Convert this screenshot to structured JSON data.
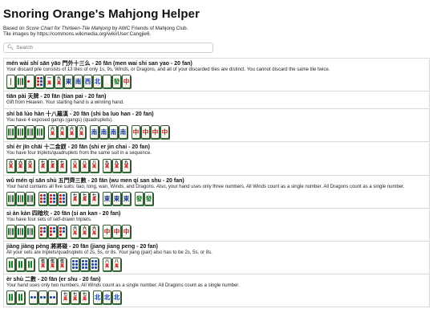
{
  "page": {
    "title": "Snoring Orange's Mahjong Helper",
    "based_on_prefix": "Based on ",
    "based_on_italic": "Score Chart for Thirteen-Tile Mahjong",
    "based_on_suffix": " by AWC Friends of Mahjong Club.",
    "images_credit": "Tile images by https://commons.wikimedia.org/wiki/User:Cangjie6.",
    "search_placeholder": "Search"
  },
  "icons": {
    "search": "magnifier-icon"
  },
  "hands": [
    {
      "title": "mén wài shí sān yāo 門外十三么 - 20 fān (men wai shi san yao - 20 fan)",
      "desc": "Your discard pile consists of 13 tiles of only 1s, 9s, Winds, or Dragons, and all of your discarded tiles are distinct. You cannot discard the same tile twice.",
      "tiles": [
        {
          "type": "bam",
          "n": 1
        },
        {
          "type": "bam",
          "n": 9
        },
        {
          "type": "dots",
          "n": 1
        },
        {
          "type": "dots",
          "n": 9
        },
        {
          "type": "char",
          "top": "一",
          "w": "萬"
        },
        {
          "type": "char",
          "top": "九",
          "w": "萬"
        },
        {
          "type": "glyph",
          "g": "東",
          "c": "b"
        },
        {
          "type": "glyph",
          "g": "南",
          "c": "b"
        },
        {
          "type": "glyph",
          "g": "西",
          "c": "b"
        },
        {
          "type": "glyph",
          "g": "北",
          "c": "b"
        },
        {
          "type": "blank"
        },
        {
          "type": "glyph",
          "g": "發",
          "c": "g"
        },
        {
          "type": "glyph",
          "g": "中",
          "c": "r"
        }
      ]
    },
    {
      "title": "tiān pài 天牌 - 20 fān (tian pai - 20 fan)",
      "desc": "Gift from Heaven. Your starting hand is a winning hand.",
      "tiles": []
    },
    {
      "title": "shí bā lúo hàn 十八羅漢 - 20 fān (shi ba luo han - 20 fan)",
      "desc": "You have 4 exposed gangs (gangs) (quadruplets).",
      "tiles": [
        {
          "type": "bam",
          "n": 3
        },
        {
          "type": "bam",
          "n": 3
        },
        {
          "type": "bam",
          "n": 3
        },
        {
          "type": "bam",
          "n": 3
        },
        {
          "type": "gap"
        },
        {
          "type": "char",
          "top": "六",
          "w": "萬"
        },
        {
          "type": "char",
          "top": "六",
          "w": "萬"
        },
        {
          "type": "char",
          "top": "六",
          "w": "萬"
        },
        {
          "type": "char",
          "top": "六",
          "w": "萬"
        },
        {
          "type": "gap"
        },
        {
          "type": "glyph",
          "g": "南",
          "c": "b"
        },
        {
          "type": "glyph",
          "g": "南",
          "c": "b"
        },
        {
          "type": "glyph",
          "g": "南",
          "c": "b"
        },
        {
          "type": "glyph",
          "g": "南",
          "c": "b"
        },
        {
          "type": "gap"
        },
        {
          "type": "glyph",
          "g": "中",
          "c": "r"
        },
        {
          "type": "glyph",
          "g": "中",
          "c": "r"
        },
        {
          "type": "glyph",
          "g": "中",
          "c": "r"
        },
        {
          "type": "glyph",
          "g": "中",
          "c": "r"
        }
      ]
    },
    {
      "title": "shí èr jīn chāi 十二金釵 - 20 fān (shi er jin chai - 20 fan)",
      "desc": "You have four triplets/quadruplets from the same suit in a sequence.",
      "tiles": [
        {
          "type": "char",
          "top": "六",
          "w": "萬"
        },
        {
          "type": "char",
          "top": "六",
          "w": "萬"
        },
        {
          "type": "char",
          "top": "六",
          "w": "萬"
        },
        {
          "type": "gap"
        },
        {
          "type": "char",
          "top": "七",
          "w": "萬"
        },
        {
          "type": "char",
          "top": "七",
          "w": "萬"
        },
        {
          "type": "char",
          "top": "七",
          "w": "萬"
        },
        {
          "type": "gap"
        },
        {
          "type": "char",
          "top": "八",
          "w": "萬"
        },
        {
          "type": "char",
          "top": "八",
          "w": "萬"
        },
        {
          "type": "char",
          "top": "八",
          "w": "萬"
        },
        {
          "type": "gap"
        },
        {
          "type": "char",
          "top": "九",
          "w": "萬"
        },
        {
          "type": "char",
          "top": "九",
          "w": "萬"
        },
        {
          "type": "char",
          "top": "九",
          "w": "萬"
        }
      ]
    },
    {
      "title": "wǔ mén qí sān shù 五門齊三數 - 20 fān (wu men qi san shu - 20 fan)",
      "desc": "Your hand contains all five suits: tiao, tong, wan, Winds, and Dragons. Also, your hand uses only three numbers. All Winds count as a single number. All Dragons count as a single number.",
      "tiles": [
        {
          "type": "bam",
          "n": 3
        },
        {
          "type": "bam",
          "n": 3
        },
        {
          "type": "bam",
          "n": 3
        },
        {
          "type": "gap"
        },
        {
          "type": "dots",
          "n": 7
        },
        {
          "type": "dots",
          "n": 7
        },
        {
          "type": "dots",
          "n": 7
        },
        {
          "type": "gap"
        },
        {
          "type": "char",
          "top": "七",
          "w": "萬"
        },
        {
          "type": "char",
          "top": "七",
          "w": "萬"
        },
        {
          "type": "char",
          "top": "七",
          "w": "萬"
        },
        {
          "type": "gap"
        },
        {
          "type": "glyph",
          "g": "東",
          "c": "b"
        },
        {
          "type": "glyph",
          "g": "東",
          "c": "b"
        },
        {
          "type": "glyph",
          "g": "東",
          "c": "b"
        },
        {
          "type": "gap"
        },
        {
          "type": "glyph",
          "g": "發",
          "c": "g"
        },
        {
          "type": "glyph",
          "g": "發",
          "c": "g"
        }
      ]
    },
    {
      "title": "sì àn kàn 四暗坎 - 20 fān (si an kan - 20 fan)",
      "desc": "You have four sets of self-drawn triplets.",
      "tiles": [
        {
          "type": "bam",
          "n": 4
        },
        {
          "type": "bam",
          "n": 4
        },
        {
          "type": "bam",
          "n": 4
        },
        {
          "type": "gap"
        },
        {
          "type": "dots",
          "n": 5
        },
        {
          "type": "dots",
          "n": 5
        },
        {
          "type": "dots",
          "n": 5
        },
        {
          "type": "gap"
        },
        {
          "type": "char",
          "top": "六",
          "w": "萬"
        },
        {
          "type": "char",
          "top": "六",
          "w": "萬"
        },
        {
          "type": "char",
          "top": "六",
          "w": "萬"
        },
        {
          "type": "gap"
        },
        {
          "type": "glyph",
          "g": "中",
          "c": "r"
        },
        {
          "type": "glyph",
          "g": "中",
          "c": "r"
        },
        {
          "type": "glyph",
          "g": "中",
          "c": "r"
        }
      ]
    },
    {
      "title": "jiàng jiàng pèng 將將碰 - 20 fān (jiang jiang peng - 20 fan)",
      "desc": "All your sets are triplets/quadruplets of 2s, 5s, or 8s. Your jiang (pair) also has to be 2s, 5s, or 8s.",
      "tiles": [
        {
          "type": "bam",
          "n": 2
        },
        {
          "type": "bam",
          "n": 2
        },
        {
          "type": "bam",
          "n": 2
        },
        {
          "type": "gap"
        },
        {
          "type": "char",
          "top": "伍",
          "w": "萬"
        },
        {
          "type": "char",
          "top": "伍",
          "w": "萬"
        },
        {
          "type": "char",
          "top": "伍",
          "w": "萬"
        },
        {
          "type": "gap"
        },
        {
          "type": "dots",
          "n": 8
        },
        {
          "type": "dots",
          "n": 8
        },
        {
          "type": "dots",
          "n": 8
        },
        {
          "type": "gap"
        },
        {
          "type": "char",
          "top": "八",
          "w": "萬"
        },
        {
          "type": "char",
          "top": "八",
          "w": "萬"
        }
      ]
    },
    {
      "title": "èr shù 二數 - 20 fān (er shu - 20 fan)",
      "desc": "Your hand uses only two numbers. All Winds count as a single number. All Dragons count as a single number.",
      "tiles": [
        {
          "type": "bam",
          "n": 2
        },
        {
          "type": "bam",
          "n": 2
        },
        {
          "type": "gap"
        },
        {
          "type": "dots",
          "n": 2
        },
        {
          "type": "dots",
          "n": 2
        },
        {
          "type": "dots",
          "n": 2
        },
        {
          "type": "gap"
        },
        {
          "type": "char",
          "top": "七",
          "w": "萬"
        },
        {
          "type": "char",
          "top": "七",
          "w": "萬"
        },
        {
          "type": "char",
          "top": "七",
          "w": "萬"
        },
        {
          "type": "gap"
        },
        {
          "type": "glyph",
          "g": "北",
          "c": "b"
        },
        {
          "type": "glyph",
          "g": "北",
          "c": "b"
        },
        {
          "type": "glyph",
          "g": "北",
          "c": "b"
        }
      ]
    }
  ]
}
